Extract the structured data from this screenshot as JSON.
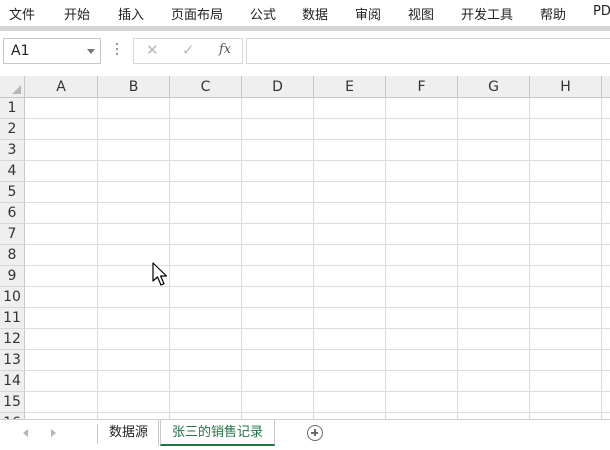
{
  "ribbon": {
    "tabs": [
      "文件",
      "开始",
      "插入",
      "页面布局",
      "公式",
      "数据",
      "审阅",
      "视图",
      "开发工具",
      "帮助",
      "PD"
    ]
  },
  "formula_bar": {
    "name_box": "A1",
    "cancel_symbol": "✕",
    "enter_symbol": "✓",
    "function_symbol": "fx",
    "formula": ""
  },
  "grid": {
    "columns": [
      "A",
      "B",
      "C",
      "D",
      "E",
      "F",
      "G",
      "H"
    ],
    "rows": [
      "1",
      "2",
      "3",
      "4",
      "5",
      "6",
      "7",
      "8",
      "9",
      "10",
      "11",
      "12",
      "13",
      "14",
      "15",
      "16"
    ]
  },
  "sheets": {
    "tabs": [
      "数据源",
      "张三的销售记录"
    ],
    "active": "张三的销售记录"
  },
  "colors": {
    "active_sheet": "#217346",
    "header_bg": "#efefef",
    "gridline": "#dcdcdc"
  }
}
